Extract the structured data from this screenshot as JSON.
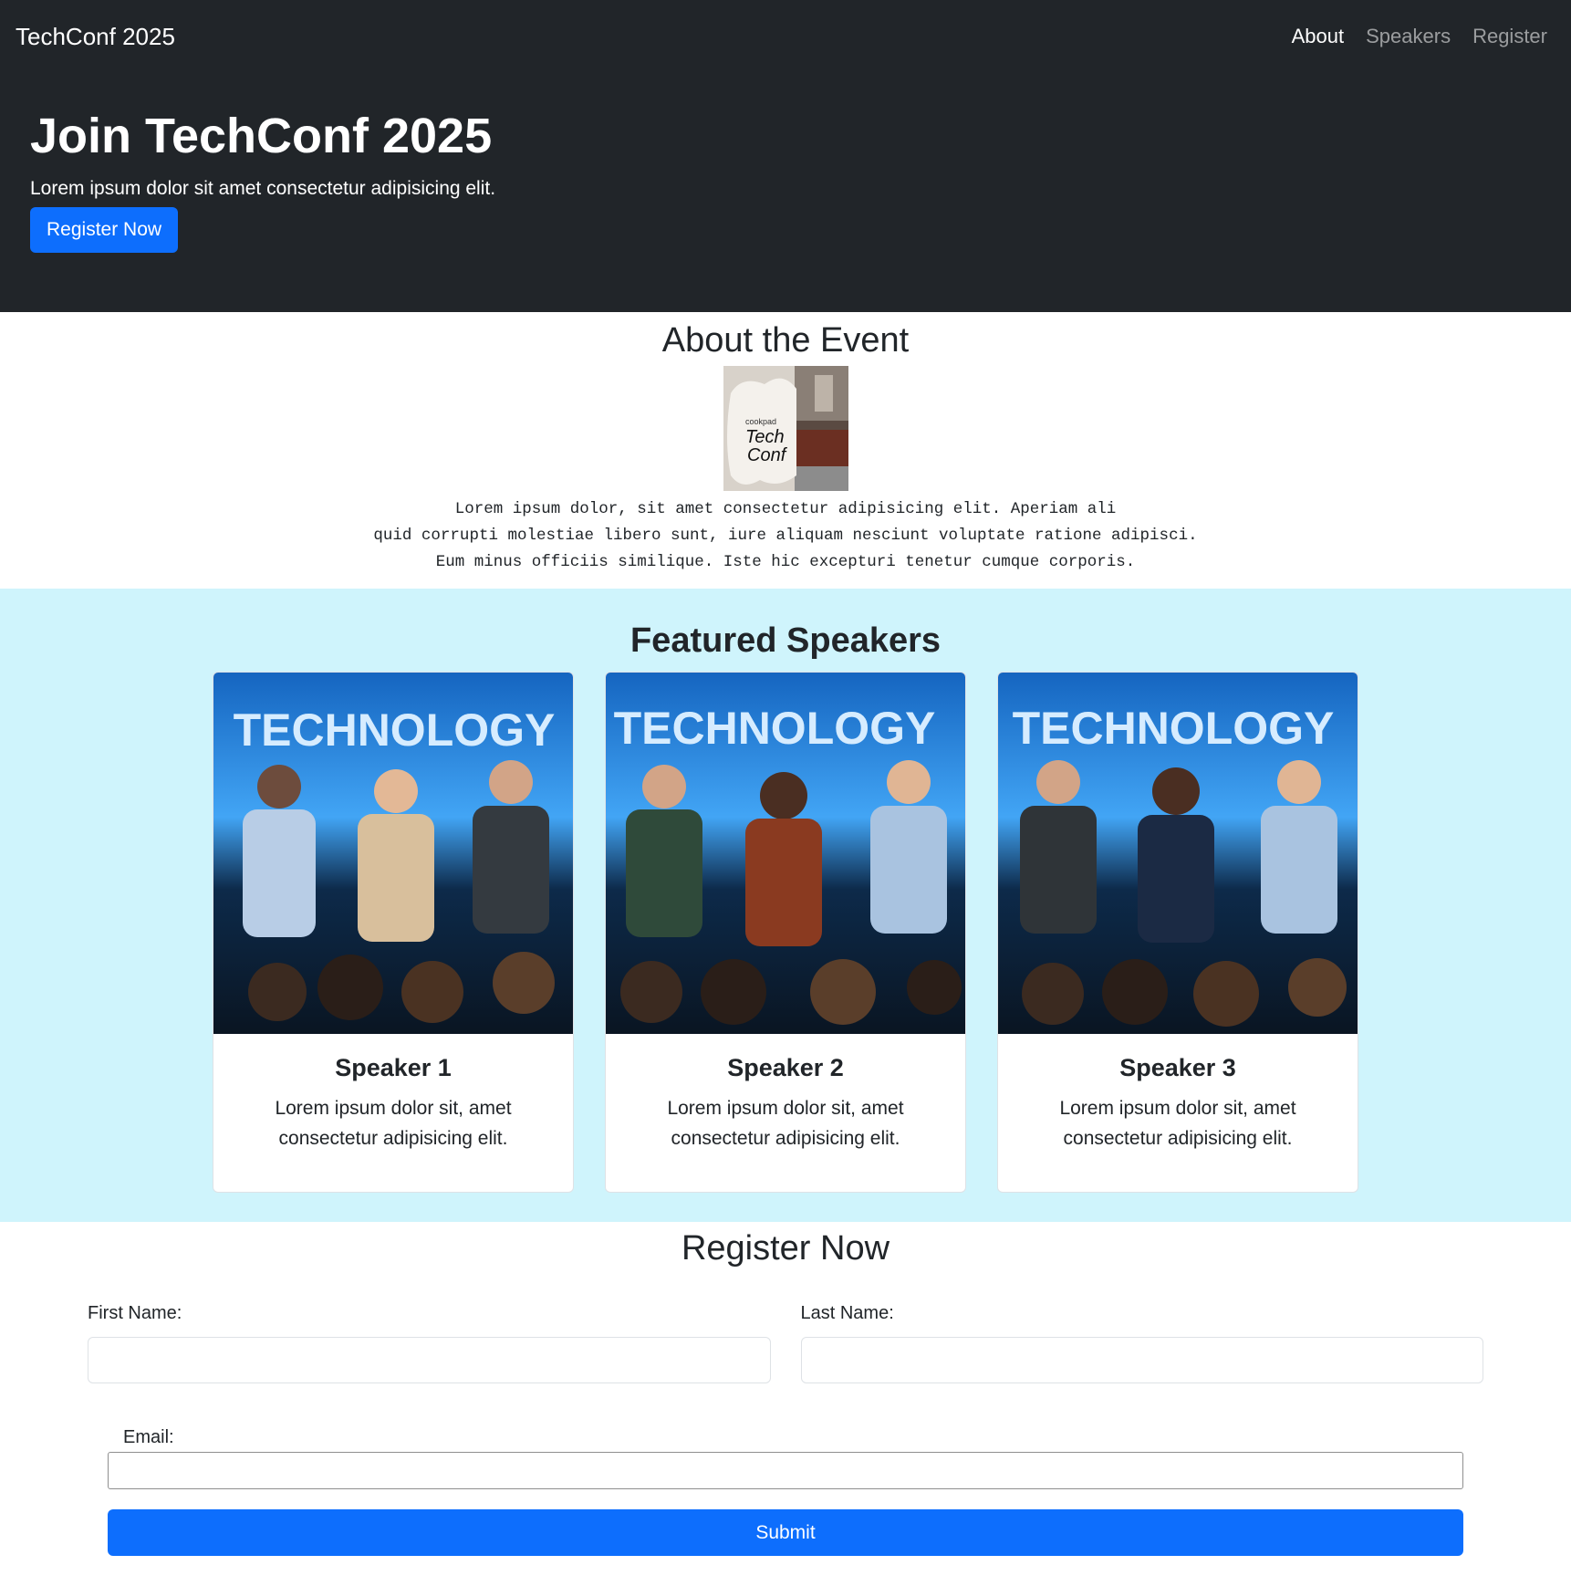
{
  "navbar": {
    "brand": "TechConf 2025",
    "links": [
      {
        "label": "About",
        "active": true
      },
      {
        "label": "Speakers",
        "active": false
      },
      {
        "label": "Register",
        "active": false
      }
    ]
  },
  "hero": {
    "title": "Join TechConf 2025",
    "subtitle": "Lorem ipsum dolor sit amet consectetur adipisicing elit.",
    "cta_label": "Register Now"
  },
  "about": {
    "heading": "About the Event",
    "image_logo_text": [
      "cookpad",
      "Tech",
      "Conf"
    ],
    "text": "Lorem ipsum dolor, sit amet consectetur adipisicing elit. Aperiam ali\nquid corrupti molestiae libero sunt, iure aliquam nesciunt voluptate ratione adipisci.\nEum minus officiis similique. Iste hic excepturi tenetur cumque corporis."
  },
  "speakers": {
    "heading": "Featured Speakers",
    "banner_text": "TECHNOLOGY",
    "items": [
      {
        "name": "Speaker 1",
        "bio": "Lorem ipsum dolor sit, amet consectetur adipisicing elit."
      },
      {
        "name": "Speaker 2",
        "bio": "Lorem ipsum dolor sit, amet consectetur adipisicing elit."
      },
      {
        "name": "Speaker 3",
        "bio": "Lorem ipsum dolor sit, amet consectetur adipisicing elit."
      }
    ]
  },
  "register": {
    "heading": "Register Now",
    "first_name_label": "First Name:",
    "last_name_label": "Last Name:",
    "email_label": "Email:",
    "first_name_value": "",
    "last_name_value": "",
    "email_value": "",
    "submit_label": "Submit"
  },
  "colors": {
    "dark": "#212529",
    "primary": "#0d6efd",
    "speakers_bg": "#cff4fc"
  }
}
